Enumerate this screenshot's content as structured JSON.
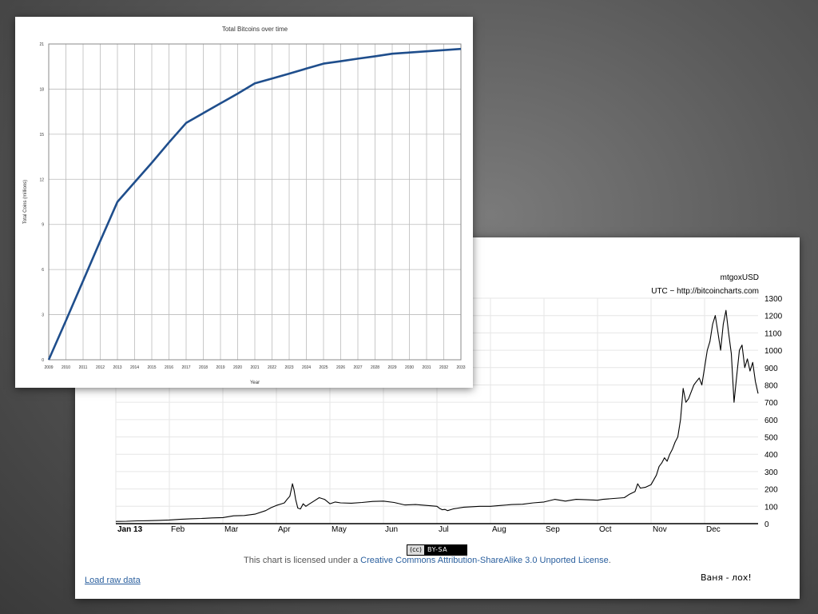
{
  "chart_data": [
    {
      "type": "line",
      "title": "Total Bitcoins over time",
      "xlabel": "Year",
      "ylabel": "Total Coins (millions)",
      "x": [
        "2009",
        "2010",
        "2011",
        "2012",
        "2013",
        "2014",
        "2015",
        "2016",
        "2017",
        "2018",
        "2019",
        "2020",
        "2021",
        "2022",
        "2023",
        "2024",
        "2025",
        "2026",
        "2027",
        "2028",
        "2029",
        "2030",
        "2031",
        "2032",
        "2033"
      ],
      "tick_labels_x": [
        "2009",
        "2010",
        "2011",
        "2012",
        "2013",
        "2014",
        "2015",
        "2016",
        "2017",
        "2018",
        "2019",
        "2020",
        "2021",
        "2022",
        "2023",
        "2024",
        "2025",
        "2026",
        "2027",
        "2028",
        "2029",
        "2030",
        "2031",
        "2032",
        "2033"
      ],
      "series": [
        {
          "values": [
            0,
            2.6,
            5.25,
            7.9,
            10.5,
            11.8,
            13.1,
            14.45,
            15.75,
            16.4,
            17.05,
            17.7,
            18.38,
            18.7,
            19.03,
            19.36,
            19.69,
            19.85,
            20.02,
            20.18,
            20.35,
            20.43,
            20.51,
            20.59,
            20.67
          ]
        }
      ],
      "ylim": [
        0,
        21
      ],
      "yticks": [
        "0",
        "3",
        "6",
        "9",
        "12",
        "15",
        "18",
        "21"
      ],
      "grid": true,
      "color": "#1f4e8c"
    },
    {
      "type": "line",
      "title": "mtgoxUSD",
      "subtitle": "UTC − http://bitcoincharts.com",
      "x": [
        "Jan 13",
        "Feb",
        "Mar",
        "Apr",
        "May",
        "Jun",
        "Jul",
        "Aug",
        "Sep",
        "Oct",
        "Nov",
        "Dec"
      ],
      "tick_labels_x": [
        "Jan 13",
        "Feb",
        "Mar",
        "Apr",
        "May",
        "Jun",
        "Jul",
        "Aug",
        "Sep",
        "Oct",
        "Nov",
        "Dec"
      ],
      "series": [
        {
          "points": [
            [
              0,
              13
            ],
            [
              0.2,
              14
            ],
            [
              0.4,
              16
            ],
            [
              0.6,
              17
            ],
            [
              0.8,
              19
            ],
            [
              1.0,
              21
            ],
            [
              1.2,
              25
            ],
            [
              1.4,
              28
            ],
            [
              1.6,
              30
            ],
            [
              1.8,
              33
            ],
            [
              2.0,
              35
            ],
            [
              2.2,
              45
            ],
            [
              2.4,
              47
            ],
            [
              2.6,
              55
            ],
            [
              2.8,
              75
            ],
            [
              2.9,
              92
            ],
            [
              3.0,
              105
            ],
            [
              3.1,
              115
            ],
            [
              3.15,
              120
            ],
            [
              3.2,
              140
            ],
            [
              3.25,
              158
            ],
            [
              3.28,
              200
            ],
            [
              3.3,
              230
            ],
            [
              3.33,
              195
            ],
            [
              3.36,
              140
            ],
            [
              3.4,
              90
            ],
            [
              3.45,
              85
            ],
            [
              3.5,
              115
            ],
            [
              3.55,
              100
            ],
            [
              3.6,
              110
            ],
            [
              3.7,
              130
            ],
            [
              3.8,
              150
            ],
            [
              3.9,
              140
            ],
            [
              4.0,
              115
            ],
            [
              4.1,
              125
            ],
            [
              4.2,
              120
            ],
            [
              4.4,
              118
            ],
            [
              4.6,
              122
            ],
            [
              4.8,
              128
            ],
            [
              5.0,
              130
            ],
            [
              5.2,
              122
            ],
            [
              5.4,
              108
            ],
            [
              5.6,
              110
            ],
            [
              5.8,
              105
            ],
            [
              6.0,
              100
            ],
            [
              6.05,
              88
            ],
            [
              6.1,
              80
            ],
            [
              6.15,
              82
            ],
            [
              6.2,
              75
            ],
            [
              6.3,
              85
            ],
            [
              6.5,
              95
            ],
            [
              6.8,
              100
            ],
            [
              7.0,
              100
            ],
            [
              7.2,
              105
            ],
            [
              7.4,
              110
            ],
            [
              7.6,
              112
            ],
            [
              7.8,
              120
            ],
            [
              8.0,
              125
            ],
            [
              8.2,
              140
            ],
            [
              8.4,
              130
            ],
            [
              8.6,
              140
            ],
            [
              8.8,
              138
            ],
            [
              9.0,
              135
            ],
            [
              9.1,
              140
            ],
            [
              9.3,
              145
            ],
            [
              9.5,
              150
            ],
            [
              9.6,
              170
            ],
            [
              9.7,
              185
            ],
            [
              9.75,
              230
            ],
            [
              9.8,
              205
            ],
            [
              9.9,
              210
            ],
            [
              10.0,
              225
            ],
            [
              10.1,
              280
            ],
            [
              10.15,
              330
            ],
            [
              10.2,
              350
            ],
            [
              10.25,
              380
            ],
            [
              10.3,
              360
            ],
            [
              10.35,
              400
            ],
            [
              10.4,
              430
            ],
            [
              10.45,
              470
            ],
            [
              10.5,
              500
            ],
            [
              10.55,
              600
            ],
            [
              10.6,
              780
            ],
            [
              10.65,
              700
            ],
            [
              10.7,
              720
            ],
            [
              10.75,
              760
            ],
            [
              10.8,
              800
            ],
            [
              10.85,
              820
            ],
            [
              10.9,
              840
            ],
            [
              10.95,
              800
            ],
            [
              11.0,
              900
            ],
            [
              11.05,
              1000
            ],
            [
              11.1,
              1050
            ],
            [
              11.15,
              1150
            ],
            [
              11.2,
              1200
            ],
            [
              11.25,
              1100
            ],
            [
              11.3,
              1000
            ],
            [
              11.35,
              1150
            ],
            [
              11.4,
              1230
            ],
            [
              11.45,
              1100
            ],
            [
              11.5,
              980
            ],
            [
              11.55,
              700
            ],
            [
              11.6,
              850
            ],
            [
              11.65,
              1000
            ],
            [
              11.7,
              1030
            ],
            [
              11.75,
              900
            ],
            [
              11.8,
              950
            ],
            [
              11.85,
              880
            ],
            [
              11.9,
              930
            ],
            [
              11.95,
              820
            ],
            [
              12.0,
              750
            ]
          ]
        }
      ],
      "ylim": [
        0,
        1300
      ],
      "yticks": [
        "0",
        "100",
        "200",
        "300",
        "400",
        "500",
        "600",
        "700",
        "800",
        "900",
        "1000",
        "1100",
        "1200",
        "1300"
      ],
      "grid": true,
      "color": "#000000"
    }
  ],
  "license": {
    "badge_cc": "(cc)",
    "badge_by": "BY-SA",
    "prefix": "This chart is licensed under a ",
    "link": "Creative Commons Attribution-ShareAlike 3.0 Unported License",
    "suffix": "."
  },
  "raw_link": "Load raw data",
  "note": "Ваня - лох!"
}
